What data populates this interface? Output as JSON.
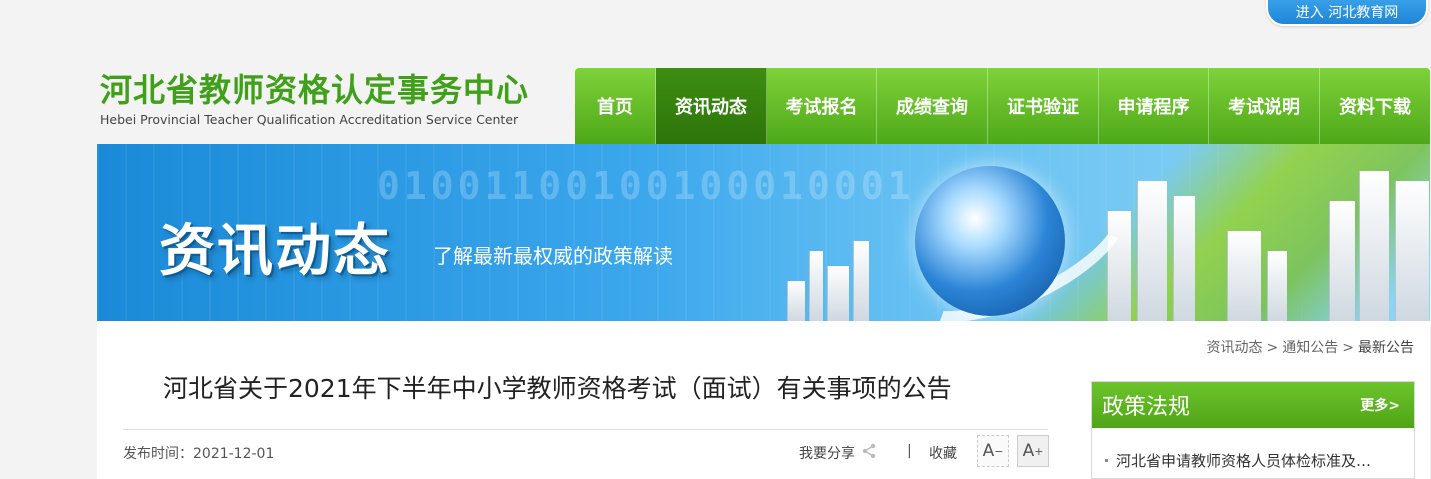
{
  "top": {
    "enter_link": "进入 河北教育网"
  },
  "logo": {
    "cn": "河北省教师资格认定事务中心",
    "en": "Hebei Provincial Teacher Qualification Accreditation Service Center"
  },
  "nav": {
    "items": [
      {
        "label": "首页",
        "active": false
      },
      {
        "label": "资讯动态",
        "active": true
      },
      {
        "label": "考试报名",
        "active": false
      },
      {
        "label": "成绩查询",
        "active": false
      },
      {
        "label": "证书验证",
        "active": false
      },
      {
        "label": "申请程序",
        "active": false
      },
      {
        "label": "考试说明",
        "active": false
      },
      {
        "label": "资料下载",
        "active": false
      }
    ]
  },
  "banner": {
    "title": "资讯动态",
    "subtitle": "了解最新最权威的政策解读",
    "binary": "01001100100100010001"
  },
  "breadcrumb": [
    "资讯动态",
    "通知公告",
    "最新公告"
  ],
  "breadcrumb_sep": ">",
  "article": {
    "title": "河北省关于2021年下半年中小学教师资格考试（面试）有关事项的公告",
    "publish_label": "发布时间：",
    "publish_date": "2021-12-01",
    "share_label": "我要分享",
    "separator": "|",
    "collect_label": "收藏",
    "font_minus": "A",
    "font_plus": "A"
  },
  "policy": {
    "title": "政策法规",
    "more": "更多>",
    "items": [
      "河北省申请教师资格人员体检标准及…"
    ]
  },
  "colors": {
    "brand_green": "#4ea818",
    "nav_active": "#2d740a",
    "link_blue": "#1e86d6"
  }
}
